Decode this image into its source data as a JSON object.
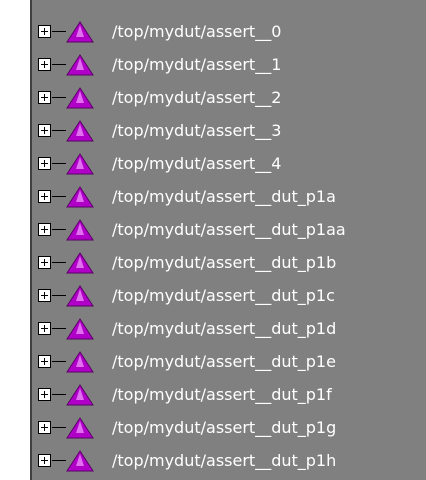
{
  "tree": {
    "colors": {
      "background": "#808080",
      "text": "#ffffff",
      "icon_fill": "#b000c8"
    },
    "items": [
      {
        "label": "/top/mydut/assert__0",
        "expander": "plus",
        "icon": "assertion-triangle-icon"
      },
      {
        "label": "/top/mydut/assert__1",
        "expander": "plus",
        "icon": "assertion-triangle-icon"
      },
      {
        "label": "/top/mydut/assert__2",
        "expander": "plus",
        "icon": "assertion-triangle-icon"
      },
      {
        "label": "/top/mydut/assert__3",
        "expander": "plus",
        "icon": "assertion-triangle-icon"
      },
      {
        "label": "/top/mydut/assert__4",
        "expander": "plus",
        "icon": "assertion-triangle-icon"
      },
      {
        "label": "/top/mydut/assert__dut_p1a",
        "expander": "plus",
        "icon": "assertion-triangle-icon"
      },
      {
        "label": "/top/mydut/assert__dut_p1aa",
        "expander": "plus",
        "icon": "assertion-triangle-icon"
      },
      {
        "label": "/top/mydut/assert__dut_p1b",
        "expander": "plus",
        "icon": "assertion-triangle-icon"
      },
      {
        "label": "/top/mydut/assert__dut_p1c",
        "expander": "plus",
        "icon": "assertion-triangle-icon"
      },
      {
        "label": "/top/mydut/assert__dut_p1d",
        "expander": "plus",
        "icon": "assertion-triangle-icon"
      },
      {
        "label": "/top/mydut/assert__dut_p1e",
        "expander": "plus",
        "icon": "assertion-triangle-icon"
      },
      {
        "label": "/top/mydut/assert__dut_p1f",
        "expander": "plus",
        "icon": "assertion-triangle-icon"
      },
      {
        "label": "/top/mydut/assert__dut_p1g",
        "expander": "plus",
        "icon": "assertion-triangle-icon"
      },
      {
        "label": "/top/mydut/assert__dut_p1h",
        "expander": "plus",
        "icon": "assertion-triangle-icon"
      }
    ]
  }
}
